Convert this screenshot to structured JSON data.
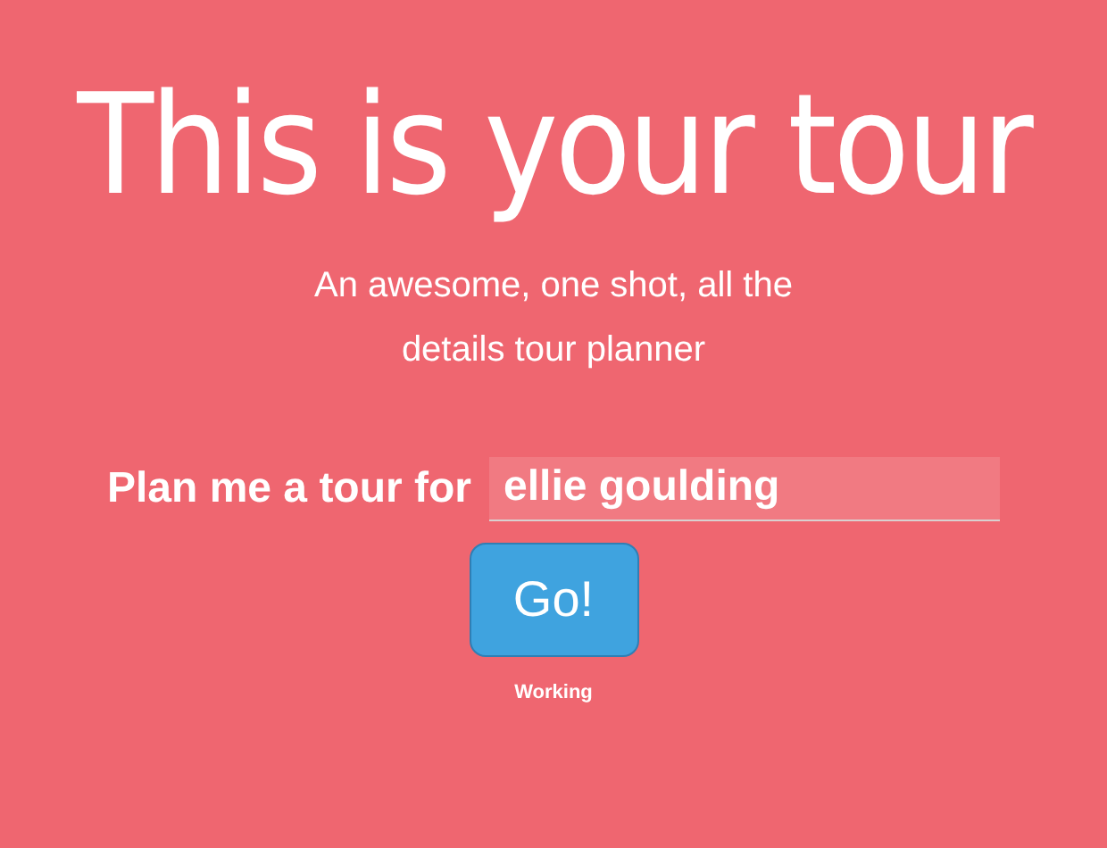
{
  "title": "This is your tour",
  "subtitle": "An awesome, one shot, all the details tour planner",
  "form": {
    "label": "Plan me a tour for",
    "value": "ellie goulding"
  },
  "button": {
    "label": "Go!"
  },
  "status": "Working"
}
